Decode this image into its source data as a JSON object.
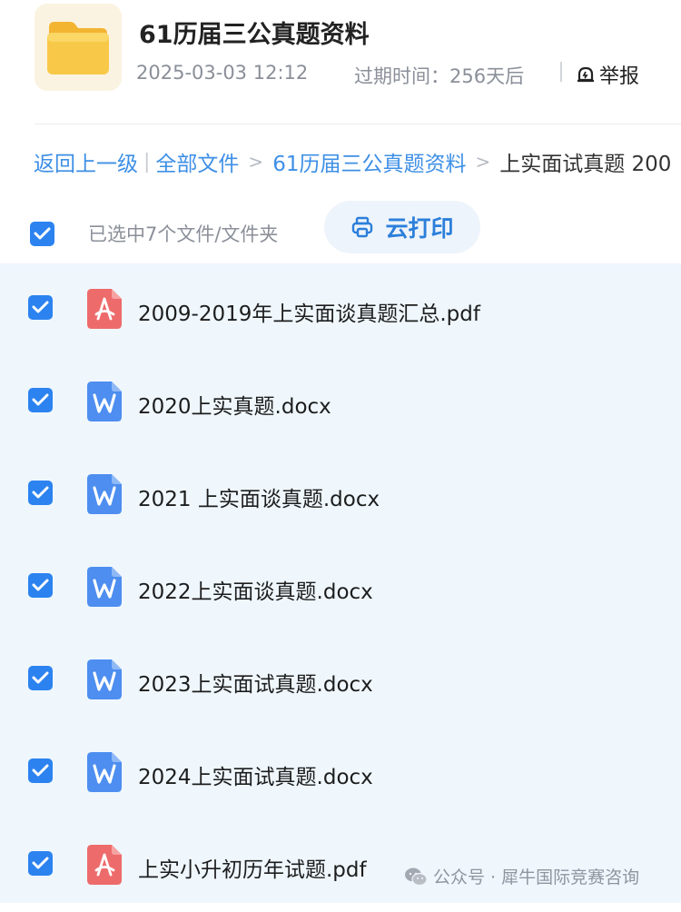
{
  "header": {
    "title": "61历届三公真题资料",
    "date": "2025-03-03 12:12",
    "expire": "过期时间：256天后",
    "report_label": "举报"
  },
  "breadcrumb": {
    "back": "返回上一级",
    "all_files": "全部文件",
    "folder": "61历届三公真题资料",
    "current": "上实面试真题 200"
  },
  "selection": {
    "text": "已选中7个文件/文件夹",
    "print_label": "云打印"
  },
  "files": [
    {
      "name": "2009-2019年上实面谈真题汇总.pdf",
      "type": "pdf",
      "checked": true
    },
    {
      "name": "2020上实真题.docx",
      "type": "word",
      "checked": true
    },
    {
      "name": "2021 上实面谈真题.docx",
      "type": "word",
      "checked": true
    },
    {
      "name": "2022上实面谈真题.docx",
      "type": "word",
      "checked": true
    },
    {
      "name": "2023上实面试真题.docx",
      "type": "word",
      "checked": true
    },
    {
      "name": "2024上实面试真题.docx",
      "type": "word",
      "checked": true
    },
    {
      "name": "上实小升初历年试题.pdf",
      "type": "pdf",
      "checked": true
    }
  ],
  "watermark": {
    "text": "公众号 · 犀牛国际竞赛咨询"
  },
  "colors": {
    "accent": "#2c83f0",
    "link": "#3e8fe6",
    "list_bg": "#eff7fd",
    "pdf_icon": "#ee6b6b",
    "word_icon": "#4d8ef0",
    "folder": "#f6c544"
  }
}
